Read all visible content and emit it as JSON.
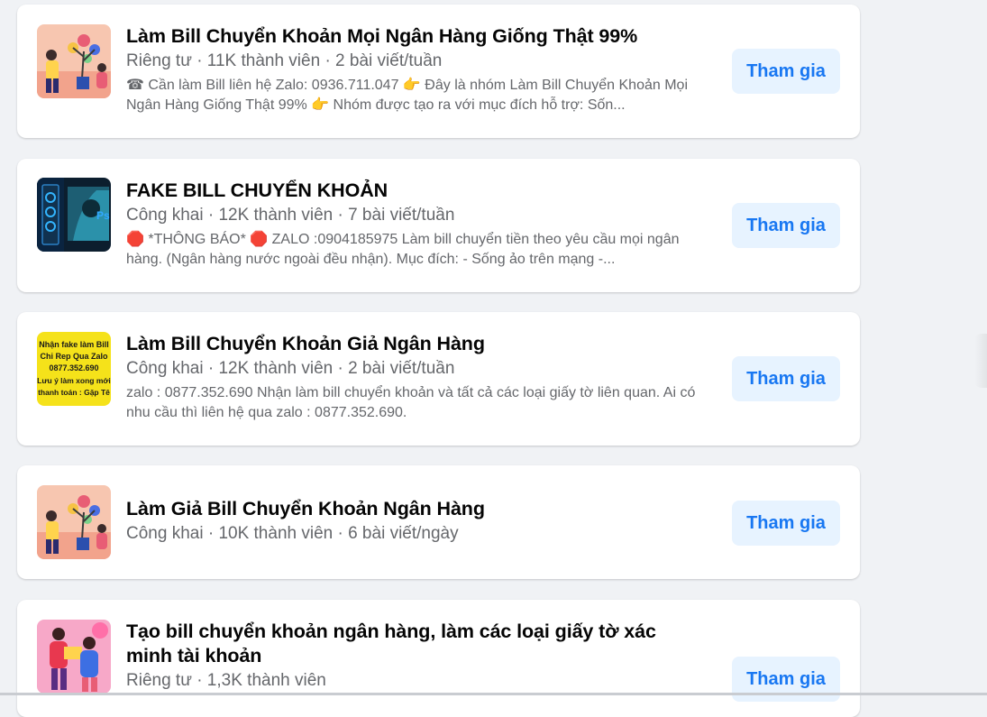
{
  "groups": [
    {
      "title": "Làm Bill Chuyển Khoản Mọi Ngân Hàng Giống Thật 99%",
      "meta": "Riêng tư · 11K thành viên · 2 bài viết/tuần",
      "description": "☎ Cần làm Bill liên hệ Zalo: 0936.711.047 👉 Đây là nhóm Làm Bill Chuyển Khoản Mọi Ngân Hàng Giống Thật 99% 👉 Nhóm được tạo ra với mục đích hỗ trợ: Sốn...",
      "join_label": "Tham gia"
    },
    {
      "title": "FAKE BILL CHUYỂN KHOẢN",
      "meta": "Công khai · 12K thành viên · 7 bài viết/tuần",
      "description": "🛑 *THÔNG BÁO* 🛑 ZALO :0904185975 Làm bill chuyển tiền theo yêu cầu mọi ngân hàng. (Ngân hàng nước ngoài đều nhận). Mục đích: - Sống ảo trên mạng -...",
      "join_label": "Tham gia"
    },
    {
      "title": "Làm Bill Chuyển Khoản Giả Ngân Hàng",
      "meta": "Công khai · 12K thành viên · 2 bài viết/tuần",
      "description": "zalo : 0877.352.690 Nhận làm bill chuyển khoản và tất cả các loại giấy tờ liên quan. Ai có nhu cầu thì liên hệ qua zalo : 0877.352.690.",
      "join_label": "Tham gia",
      "thumb_text": [
        "Nhận fake làm Bill",
        "Chỉ Rep Qua Zalo",
        "0877.352.690",
        "Lưu ý làm xong mới",
        "thanh toán : Gặp Tê"
      ]
    },
    {
      "title": "Làm Giả Bill Chuyển Khoản Ngân Hàng",
      "meta": "Công khai · 10K thành viên · 6 bài viết/ngày",
      "join_label": "Tham gia"
    },
    {
      "title": "Tạo bill chuyển khoản ngân hàng, làm các loại giấy tờ xác minh tài khoản",
      "meta": "Riêng tư · 1,3K thành viên",
      "join_label": "Tham gia"
    }
  ],
  "colors": {
    "background": "#f0f2f5",
    "join_button_bg": "#e7f3ff",
    "join_button_text": "#1877f2",
    "meta_text": "#65676b"
  }
}
